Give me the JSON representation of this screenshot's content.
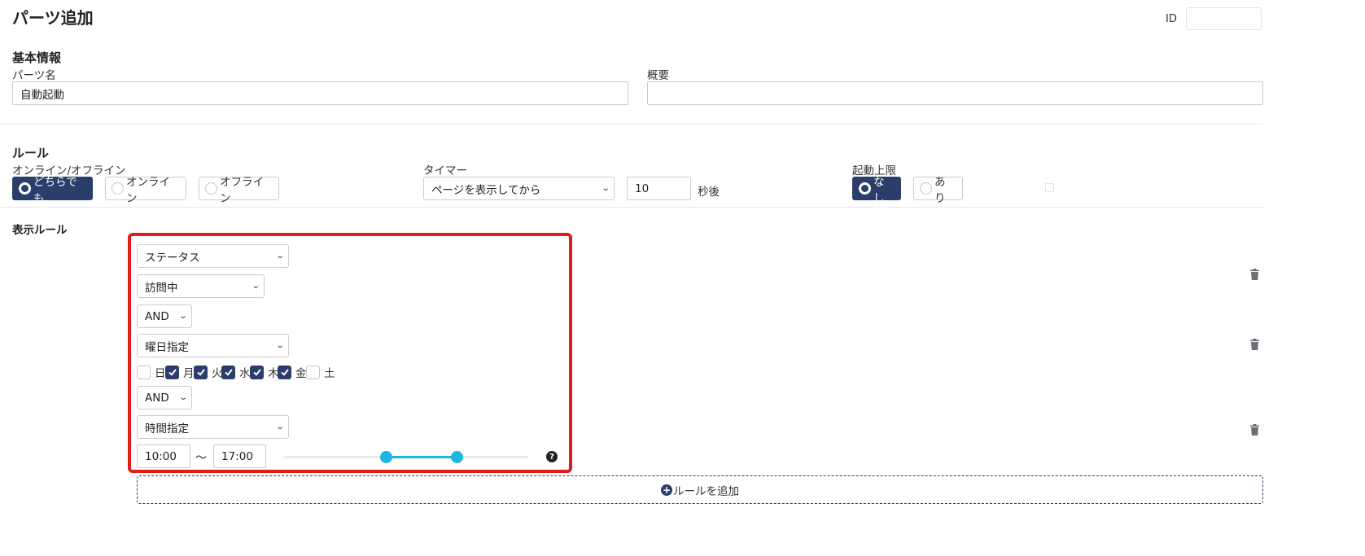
{
  "page": {
    "title": "パーツ追加",
    "id_label": "ID",
    "id_value": ""
  },
  "basic": {
    "heading": "基本情報",
    "name_label": "パーツ名",
    "name_value": "自動起動",
    "summary_label": "概要",
    "summary_value": ""
  },
  "rules": {
    "heading": "ルール",
    "online_label": "オンライン/オフライン",
    "online_options": [
      "どちらでも",
      "オンライン",
      "オフライン"
    ],
    "online_selected": "どちらでも",
    "timer_label": "タイマー",
    "timer_select": "ページを表示してから",
    "timer_value": "10",
    "timer_unit": "秒後",
    "limit_label": "起動上限",
    "limit_options": [
      "なし",
      "あり"
    ],
    "limit_selected": "なし"
  },
  "display_rules": {
    "heading": "表示ルール",
    "condition1_type": "ステータス",
    "condition1_value": "訪問中",
    "and1": "AND",
    "condition2_type": "曜日指定",
    "weekdays": [
      {
        "label": "日",
        "checked": false
      },
      {
        "label": "月",
        "checked": true
      },
      {
        "label": "火",
        "checked": true
      },
      {
        "label": "水",
        "checked": true
      },
      {
        "label": "木",
        "checked": true
      },
      {
        "label": "金",
        "checked": true
      },
      {
        "label": "土",
        "checked": false
      }
    ],
    "and2": "AND",
    "condition3_type": "時間指定",
    "time_start": "10:00",
    "time_separator": "〜",
    "time_end": "17:00",
    "slider": {
      "start_fraction": 0.417,
      "end_fraction": 0.708
    },
    "help_icon": "?",
    "add_rule_label": "ルールを追加"
  },
  "colors": {
    "primary": "#2b3e6b",
    "accent": "#1fb5e0",
    "highlight": "#e21b1b"
  },
  "icons": [
    "trash-icon",
    "plus-circle-icon",
    "help-icon",
    "chevron-down-icon",
    "check-icon"
  ]
}
